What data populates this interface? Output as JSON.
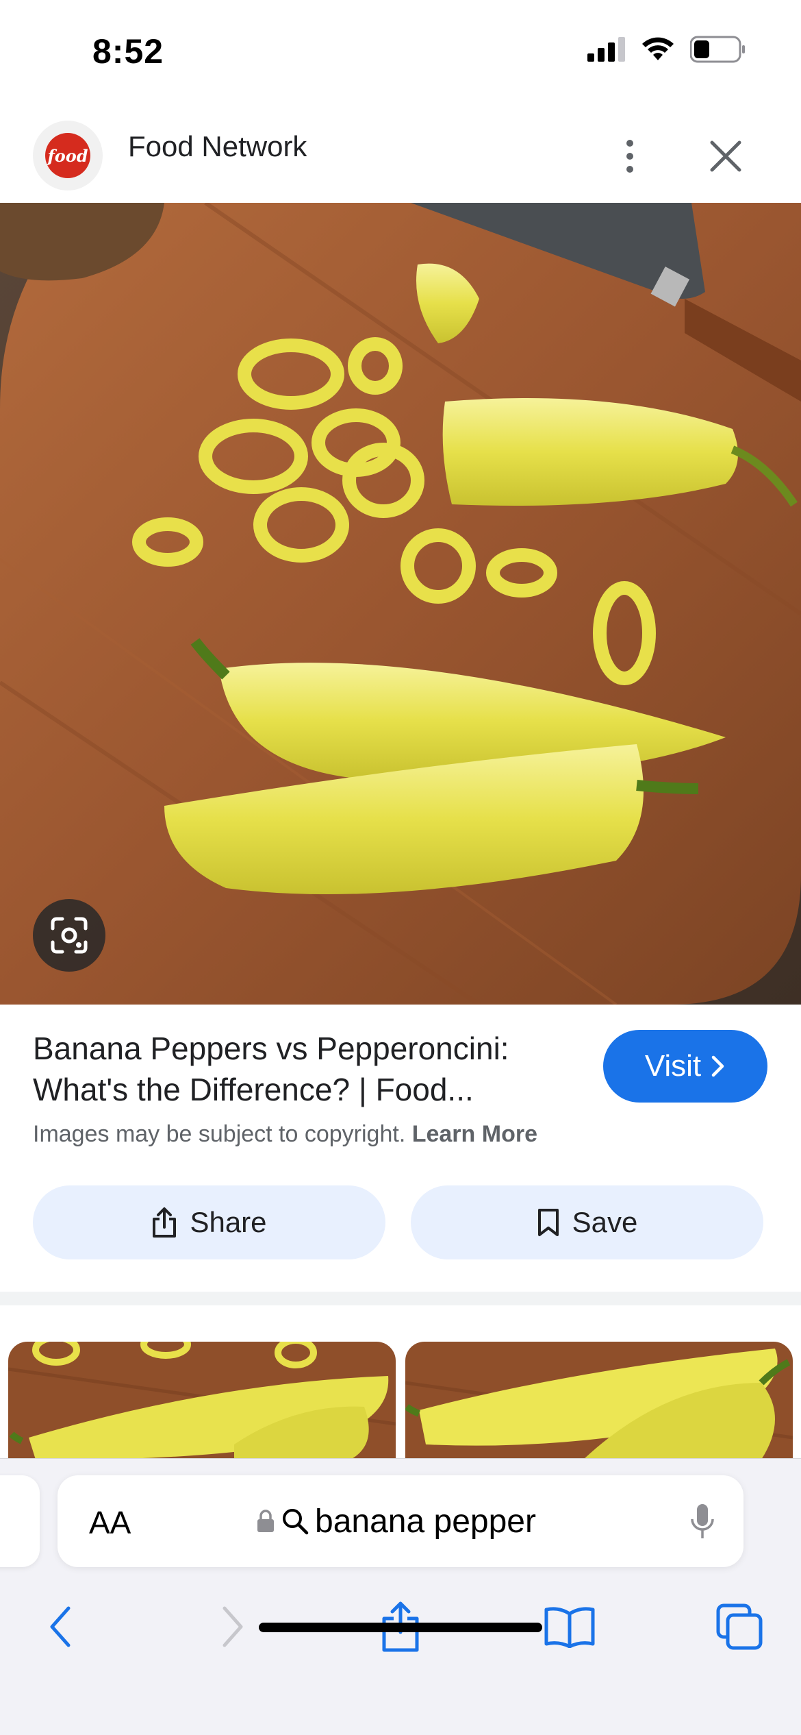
{
  "status_bar": {
    "time": "8:52",
    "icons": [
      "cellular-signal-icon",
      "wifi-icon",
      "battery-icon"
    ]
  },
  "header": {
    "site_logo_text": "food",
    "site_name": "Food Network",
    "icons": [
      "more-vert-icon",
      "close-icon"
    ]
  },
  "hero": {
    "lens_icon": "google-lens-icon"
  },
  "result": {
    "title": "Banana Peppers vs Pepperoncini: What's the Difference? | Food...",
    "visit_label": "Visit",
    "copyright_text": "Images may be subject to copyright.",
    "learn_more_label": "Learn More"
  },
  "actions": {
    "share_label": "Share",
    "save_label": "Save"
  },
  "safari": {
    "aa_label": "AA",
    "url_text": "banana pepper",
    "icons": [
      "lock-icon",
      "search-icon",
      "microphone-icon",
      "back-icon",
      "forward-icon",
      "share-icon",
      "bookmarks-icon",
      "tabs-icon"
    ]
  },
  "colors": {
    "accent": "#1a73e8",
    "button_bg": "#e8f0fe",
    "brand": "#d52b1e"
  }
}
